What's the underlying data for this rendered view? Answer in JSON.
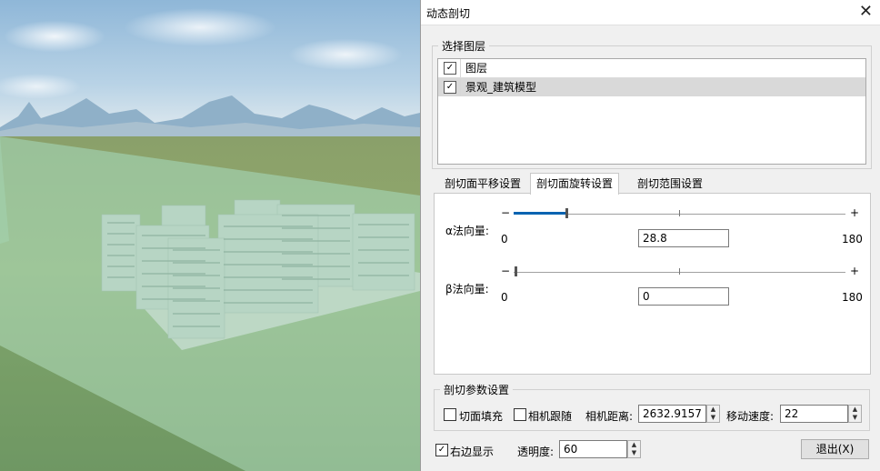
{
  "dialog": {
    "title": "动态剖切",
    "close_glyph": "✕"
  },
  "layers": {
    "legend": "选择图层",
    "header": {
      "label": "图层",
      "checked": true
    },
    "items": [
      {
        "label": "景观_建筑模型",
        "checked": true
      }
    ]
  },
  "tabs": [
    {
      "label": "剖切面平移设置",
      "active": false
    },
    {
      "label": "剖切面旋转设置",
      "active": true
    },
    {
      "label": "剖切范围设置",
      "active": false
    }
  ],
  "rotation": {
    "alpha": {
      "label": "α法向量:",
      "min": "0",
      "max": "180",
      "value": "28.8",
      "fraction": 0.16,
      "minus": "−",
      "plus": "+"
    },
    "beta": {
      "label": "β法向量:",
      "min": "0",
      "max": "180",
      "value": "0",
      "fraction": 0.0,
      "minus": "−",
      "plus": "+"
    }
  },
  "params": {
    "legend": "剖切参数设置",
    "fill_label": "切面填充",
    "fill_checked": false,
    "follow_label": "相机跟随",
    "follow_checked": false,
    "distance_label": "相机距离:",
    "distance_value": "2632.9157",
    "speed_label": "移动速度:",
    "speed_value": "22"
  },
  "footer": {
    "right_display_label": "右边显示",
    "right_display_checked": true,
    "opacity_label": "透明度:",
    "opacity_value": "60",
    "exit_label": "退出(X)"
  },
  "colors": {
    "accent": "#0063b1"
  }
}
